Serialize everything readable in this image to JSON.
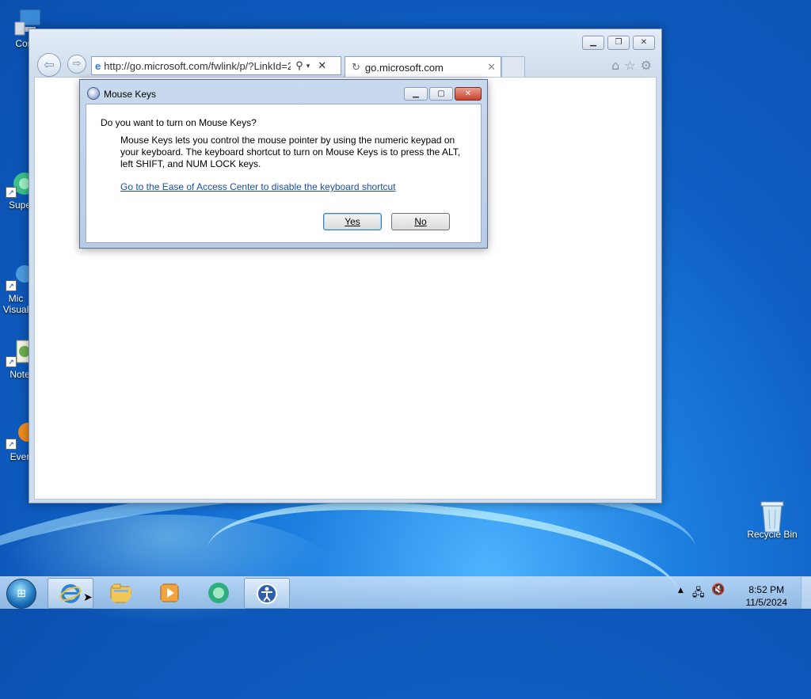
{
  "desktop": {
    "icons": [
      {
        "label": "Com",
        "glyph": "computer-icon"
      },
      {
        "label": "Supe",
        "glyph": "super-icon"
      },
      {
        "label": "Mic Visual",
        "glyph": "visual-studio-icon"
      },
      {
        "label": "Note",
        "glyph": "notepad-icon"
      },
      {
        "label": "Ever",
        "glyph": "everything-icon"
      }
    ],
    "recycle_bin": "Recycle Bin"
  },
  "browser": {
    "address_url": "http://go.microsoft.com/fwlink/p/?LinkId=2",
    "tab_title": "go.microsoft.com"
  },
  "dialog": {
    "title": "Mouse Keys",
    "question": "Do you want to turn on Mouse Keys?",
    "description": "Mouse Keys lets you control the mouse pointer by using the numeric keypad on your keyboard.  The keyboard shortcut to turn on Mouse Keys is to press the ALT, left SHIFT, and NUM LOCK keys.",
    "link": "Go to the Ease of Access Center to disable the keyboard shortcut",
    "yes_label": "Yes",
    "no_label": "No"
  },
  "taskbar": {
    "time": "8:52 PM",
    "date": "11/5/2024"
  }
}
